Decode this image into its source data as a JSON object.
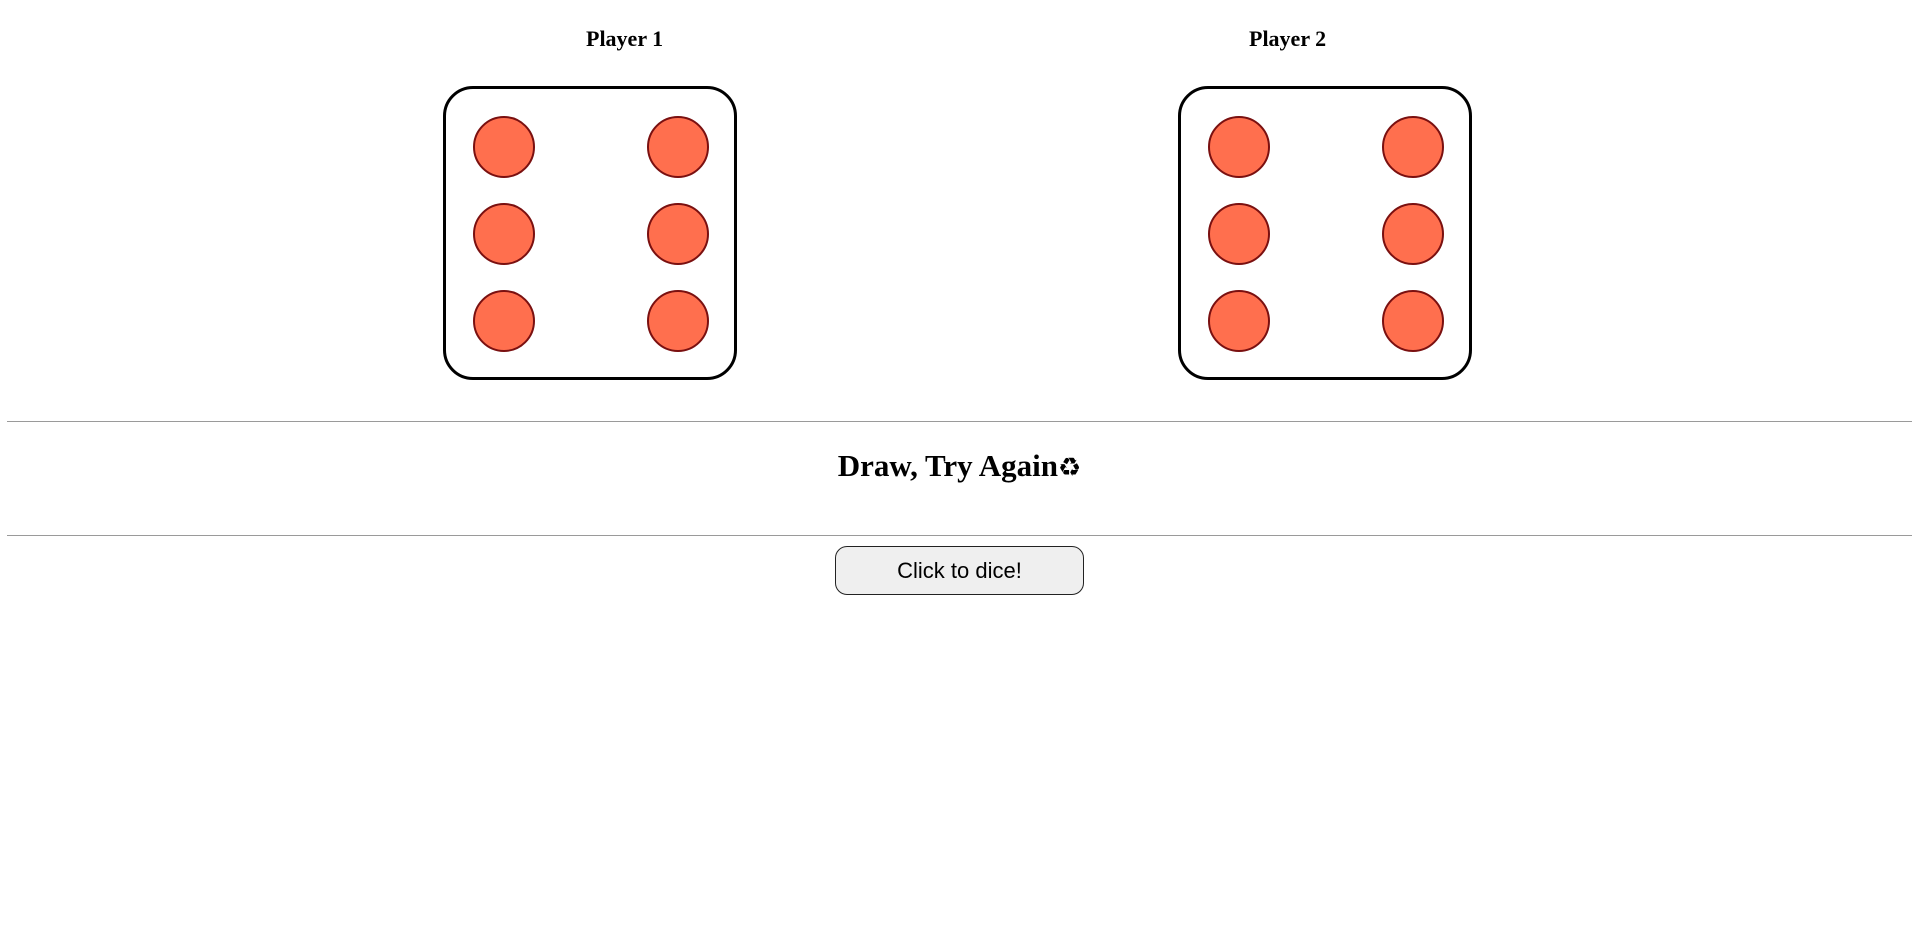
{
  "players": [
    {
      "title": "Player 1",
      "die_value": 6
    },
    {
      "title": "Player 2",
      "die_value": 6
    }
  ],
  "result": {
    "text": "Draw, Try Again",
    "icon": "recycle-icon",
    "icon_glyph": "♻"
  },
  "button": {
    "label": "Click to dice!"
  },
  "colors": {
    "pip_fill": "#ff6f4e",
    "pip_border": "#7a1010",
    "die_border": "#000000"
  }
}
